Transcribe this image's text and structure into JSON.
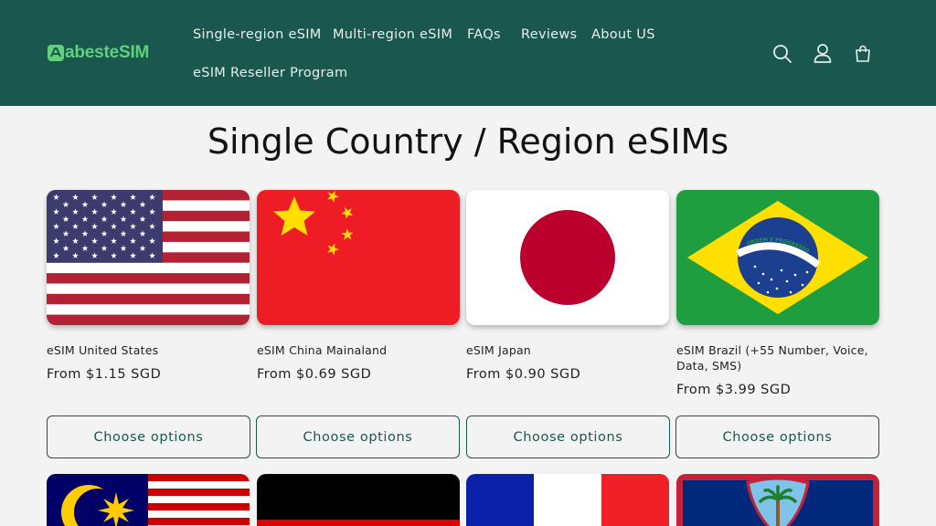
{
  "header": {
    "logo_text": "abesteSIM",
    "nav": [
      {
        "label": "Single-region eSIM"
      },
      {
        "label": "Multi-region eSIM"
      },
      {
        "label": "FAQs"
      },
      {
        "label": "Reviews"
      },
      {
        "label": "About US"
      },
      {
        "label": "eSIM Reseller Program"
      }
    ],
    "icons": [
      "search-icon",
      "account-icon",
      "cart-icon"
    ]
  },
  "main": {
    "title": "Single Country / Region eSIMs",
    "products": [
      {
        "name": "eSIM United States",
        "price": "From $1.15 SGD",
        "button": "Choose options",
        "flag": "us-flag"
      },
      {
        "name": "eSIM China Mainaland",
        "price": "From $0.69 SGD",
        "button": "Choose options",
        "flag": "cn-flag"
      },
      {
        "name": "eSIM Japan",
        "price": "From $0.90 SGD",
        "button": "Choose options",
        "flag": "jp-flag"
      },
      {
        "name": "eSIM Brazil (+55 Number, Voice, Data, SMS)",
        "price": "From $3.99 SGD",
        "button": "Choose options",
        "flag": "br-flag",
        "flag_motto": "ORDEM E PROGRESSO"
      }
    ],
    "next_row_flags": [
      "my-flag",
      "de-flag",
      "fr-flag",
      "gu-flag"
    ]
  },
  "colors": {
    "header_bg": "#19574f",
    "logo": "#5fd17a",
    "button_border": "#19574f",
    "page_bg": "#f3f3f3"
  }
}
